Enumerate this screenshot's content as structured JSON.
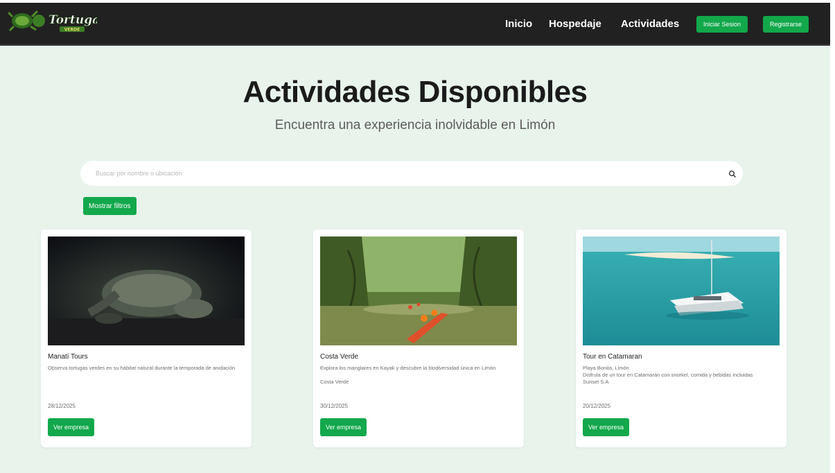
{
  "brand": {
    "logo_text": "Tortuga",
    "logo_subtext": "VERDE"
  },
  "nav": {
    "links": [
      "Inicio",
      "Hospedaje",
      "Actividades"
    ],
    "login_label": "Iniciar Sesion",
    "register_label": "Registrarse"
  },
  "hero": {
    "title": "Actividades Disponibles",
    "subtitle": "Encuentra una experiencia inolvidable en Limón"
  },
  "search": {
    "placeholder": "Buscar por nombre o ubicación",
    "value": ""
  },
  "filters_label": "Mostrar filtros",
  "cards": [
    {
      "title": "Manatí Tours",
      "details": [
        "Observa tortugas verdes en su hábitat natural durante la temporada de anidación"
      ],
      "date": "28/12/2025",
      "button": "Ver empresa",
      "image": "turtle-on-beach-at-night-photo"
    },
    {
      "title": "Costa Verde",
      "details": [
        "Explora los manglares en Kayak y descubre la biodiversidad única en Limón",
        "",
        "Costa Verde"
      ],
      "date": "30/12/2025",
      "button": "Ver empresa",
      "image": "kayaking-in-mangroves-photo"
    },
    {
      "title": "Tour en Catamaran",
      "details": [
        "Playa Bonita, Limón",
        "Disfruta de un tour en Catamarán con snorkel, comida y bebidas incluidas",
        "Sunset S.A"
      ],
      "date": "20/12/2025",
      "button": "Ver empresa",
      "image": "catamaran-turquoise-sea-photo"
    }
  ],
  "colors": {
    "accent": "#12a84b",
    "navbar": "#212121",
    "background": "#e8f3ec"
  }
}
